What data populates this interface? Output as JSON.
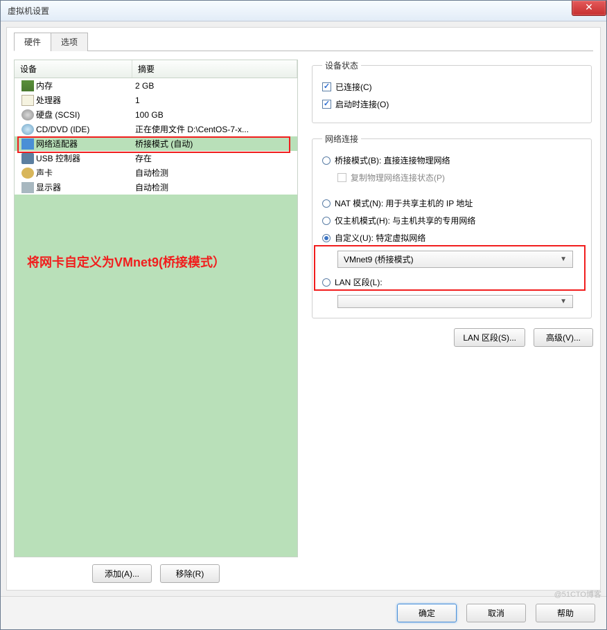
{
  "window": {
    "title": "虚拟机设置"
  },
  "tabs": {
    "hardware": "硬件",
    "options": "选项"
  },
  "columns": {
    "device": "设备",
    "summary": "摘要"
  },
  "devices": [
    {
      "name": "内存",
      "summary": "2 GB",
      "icon": "ic-mem"
    },
    {
      "name": "处理器",
      "summary": "1",
      "icon": "ic-cpu"
    },
    {
      "name": "硬盘 (SCSI)",
      "summary": "100 GB",
      "icon": "ic-disk"
    },
    {
      "name": "CD/DVD (IDE)",
      "summary": "正在使用文件 D:\\CentOS-7-x...",
      "icon": "ic-cd"
    },
    {
      "name": "网络适配器",
      "summary": "桥接模式 (自动)",
      "icon": "ic-net"
    },
    {
      "name": "USB 控制器",
      "summary": "存在",
      "icon": "ic-usb"
    },
    {
      "name": "声卡",
      "summary": "自动检测",
      "icon": "ic-sound"
    },
    {
      "name": "显示器",
      "summary": "自动检测",
      "icon": "ic-display"
    }
  ],
  "annotation": "将网卡自定义为VMnet9(桥接模式）",
  "left_buttons": {
    "add": "添加(A)...",
    "remove": "移除(R)"
  },
  "status_group": {
    "legend": "设备状态",
    "connected": "已连接(C)",
    "connect_on_start": "启动时连接(O)"
  },
  "network_group": {
    "legend": "网络连接",
    "bridged": "桥接模式(B): 直接连接物理网络",
    "replicate": "复制物理网络连接状态(P)",
    "nat": "NAT 模式(N): 用于共享主机的 IP 地址",
    "hostonly": "仅主机模式(H): 与主机共享的专用网络",
    "custom": "自定义(U): 特定虚拟网络",
    "custom_value": "VMnet9 (桥接模式)",
    "lan": "LAN 区段(L):",
    "lan_value": ""
  },
  "right_buttons": {
    "lan": "LAN 区段(S)...",
    "advanced": "高级(V)..."
  },
  "footer": {
    "ok": "确定",
    "cancel": "取消",
    "help": "帮助"
  },
  "watermark": "@51CTO博客"
}
